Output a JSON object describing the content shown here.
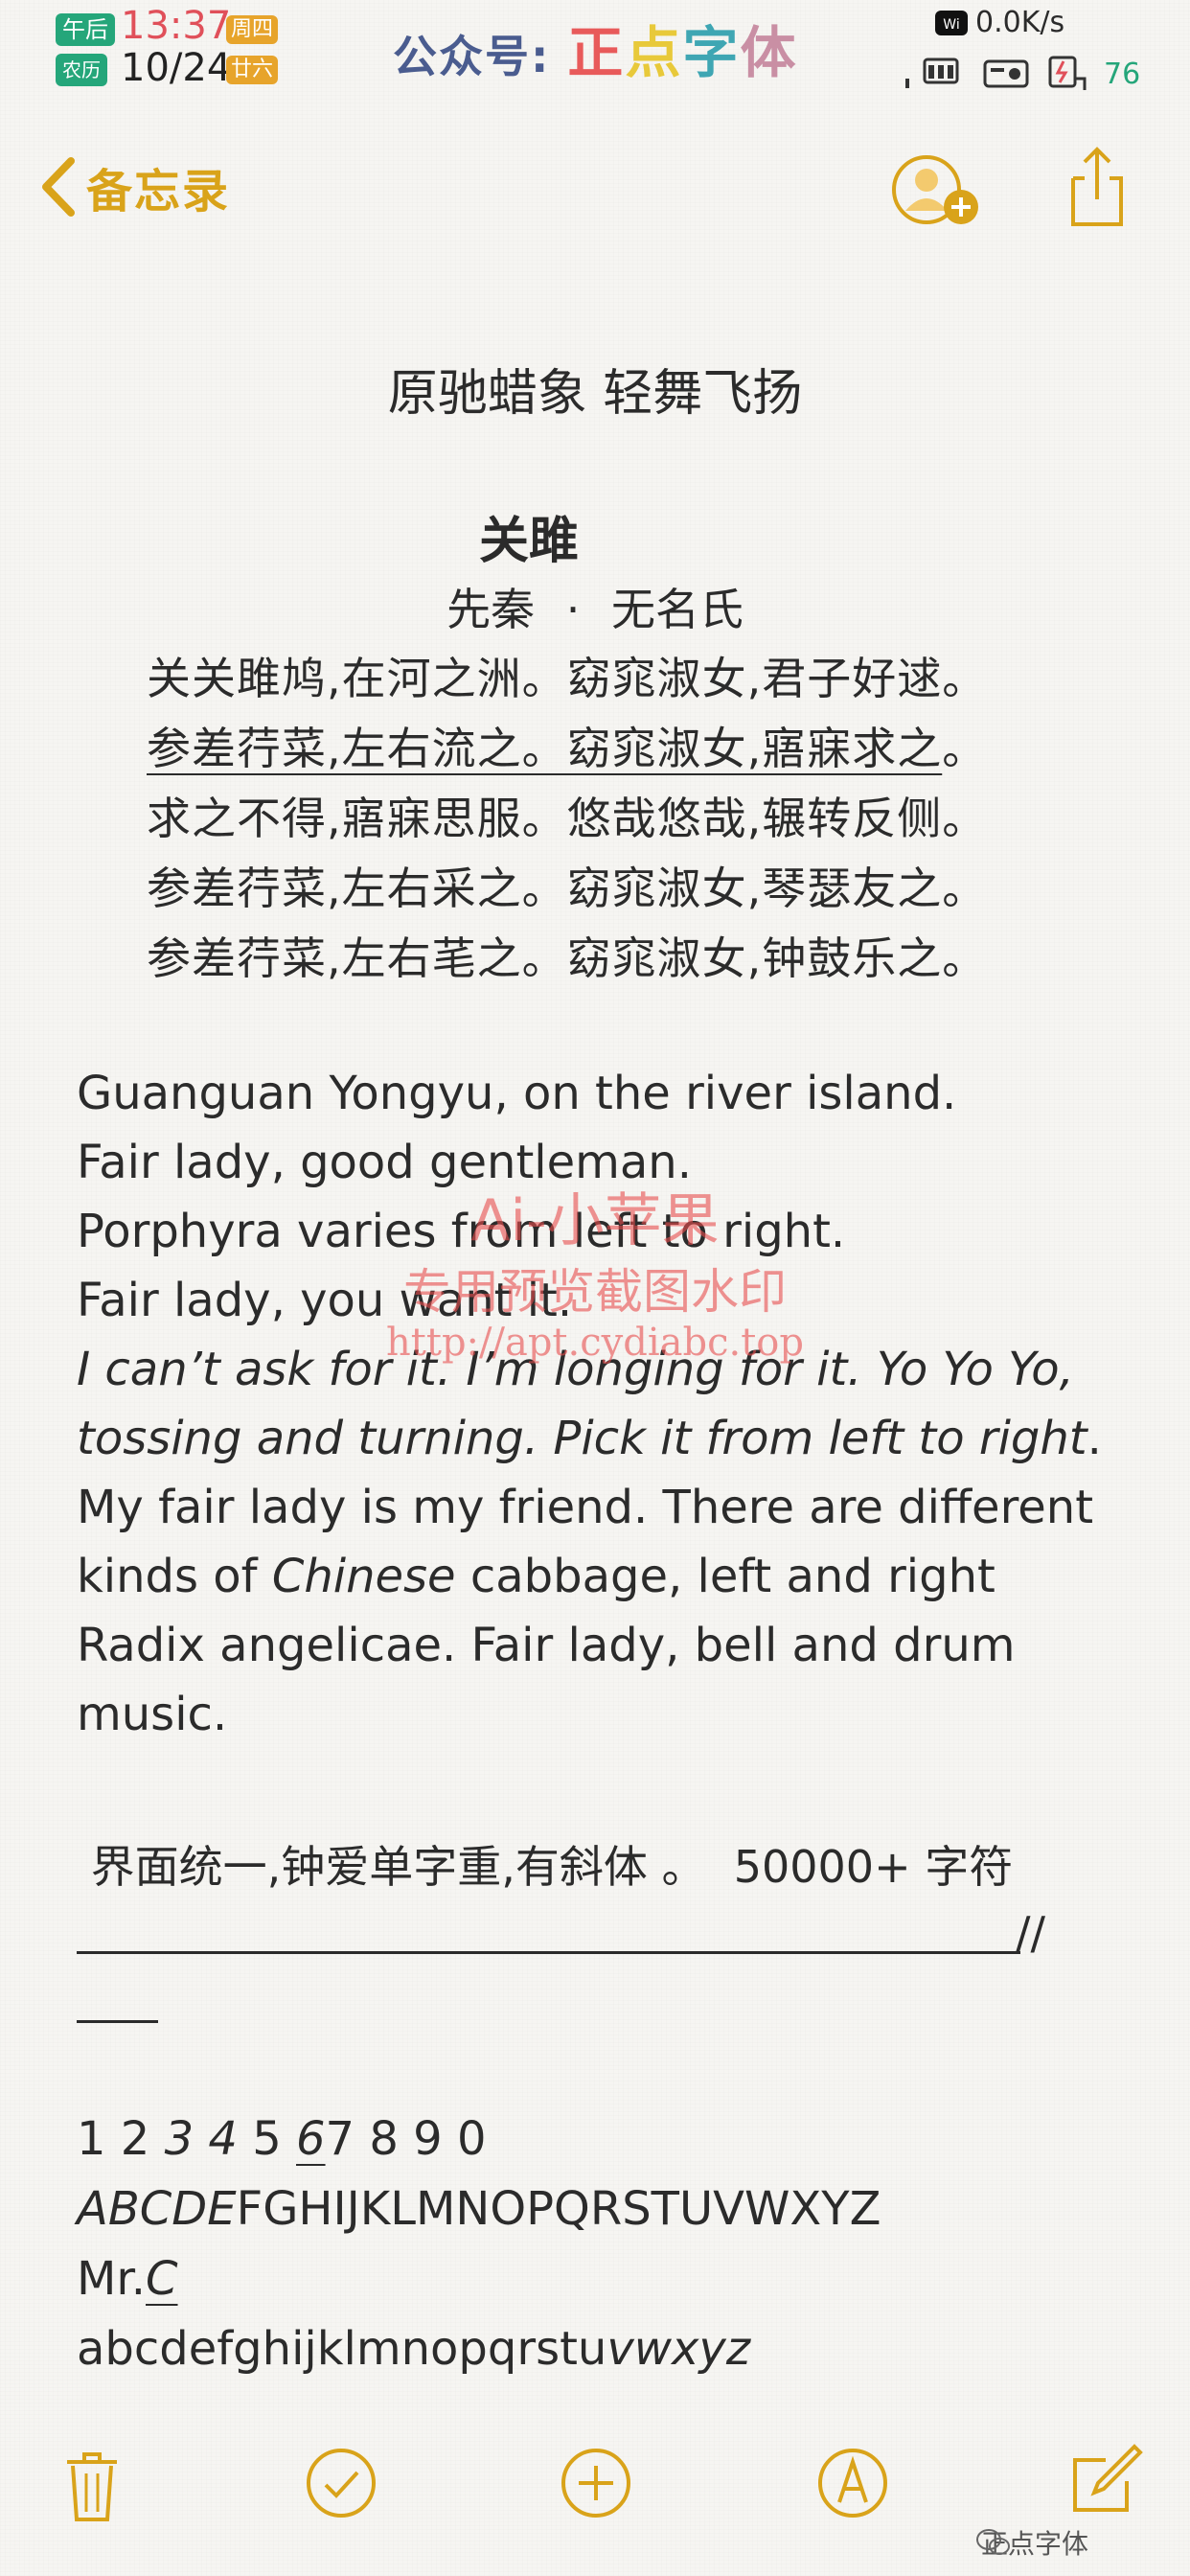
{
  "status_bar": {
    "am_pm": "午后",
    "time": "13:37",
    "weekday": "周四",
    "calendar_label": "农历",
    "lunar_date": "10/24",
    "lunar_day": "廿六",
    "brand_prefix": "公众号: ",
    "brand_chars": [
      "正",
      "点",
      "字",
      "体"
    ],
    "network_speed": "0.0K/s",
    "battery": "76",
    "colors": {
      "time": "#e0505a",
      "green": "#25a67a",
      "orange": "#e7a42b"
    }
  },
  "nav": {
    "back_label": "备忘录",
    "icons": [
      "chevron-left-icon",
      "add-person-icon",
      "share-icon"
    ],
    "accent": "#d9a31a"
  },
  "note": {
    "heading": "原驰蜡象 轻舞飞扬",
    "poem_title": "关雎",
    "poem_author_dynasty": "先秦",
    "poem_author_sep": "·",
    "poem_author": "无名氏",
    "poem_lines": [
      {
        "text": "关关雎鸠,在河之洲。窈窕淑女,君子好逑。",
        "underlined": false
      },
      {
        "text": "参差荇菜,左右流之。窈窕淑女,寤寐求之",
        "tail": "。",
        "underlined": true
      },
      {
        "text": "求之不得,寤寐思服。悠哉悠哉,辗转反侧。",
        "underlined": false
      },
      {
        "text": "参差荇菜,左右采之。窈窕淑女,琴瑟友之。",
        "underlined": false
      },
      {
        "text": "参差荇菜,左右芼之。窈窕淑女,钟鼓乐之。",
        "underlined": false
      }
    ],
    "english": {
      "l1": "Guanguan Yongyu, on the river island.",
      "l2": "Fair lady, good gentleman.",
      "l3": "Porphyra varies from left to right.",
      "l4": "Fair lady, you want it.",
      "l5": "I can’t ask for it. I’m longing for it. Yo Yo Yo,",
      "l6": "tossing and turning. Pick it from left to right",
      "l6_end": ".",
      "l7": "My fair lady is my friend. There are different",
      "l8_a": "kinds of ",
      "l8_b": "Chinese",
      "l8_c": " cabbage, left and right",
      "l9": "Radix angelicae. Fair lady, bell and drum",
      "l10": "music."
    },
    "feature_line": " 界面统一,钟爱单字重,有斜体 。  50000+ 字符",
    "rule_tail": "//",
    "digits_a": "1 2 ",
    "digits_b": "3 4",
    "digits_c": " 5 ",
    "digits_d": "6",
    "digits_e": "7 8 9 0",
    "upper_a": "ABCDE",
    "upper_b": "FGHIJKLMNOPQRSTUVWXYZ",
    "mr_a": "Mr.",
    "mr_b": "C",
    "lower_a": "abcdefghijklmnopqrstu",
    "lower_b": "vwxyz"
  },
  "watermark": {
    "line1": "Ai-小苹果",
    "line2": "专用预览截图水印",
    "line3": "http://apt.cydiabc.top"
  },
  "toolbar": {
    "icons": [
      "trash-icon",
      "checklist-icon",
      "add-icon",
      "markup-icon",
      "compose-icon"
    ],
    "wechat_label": "正点字体"
  }
}
